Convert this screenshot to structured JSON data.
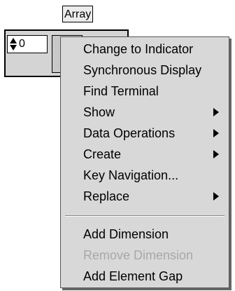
{
  "array_control": {
    "label": "Array",
    "index_value": "0"
  },
  "context_menu": {
    "items": [
      {
        "label": "Change to Indicator",
        "submenu": false,
        "enabled": true
      },
      {
        "label": "Synchronous Display",
        "submenu": false,
        "enabled": true
      },
      {
        "label": "Find Terminal",
        "submenu": false,
        "enabled": true
      },
      {
        "label": "Show",
        "submenu": true,
        "enabled": true
      },
      {
        "label": "Data Operations",
        "submenu": true,
        "enabled": true
      },
      {
        "label": "Create",
        "submenu": true,
        "enabled": true
      },
      {
        "label": "Key Navigation...",
        "submenu": false,
        "enabled": true
      },
      {
        "label": "Replace",
        "submenu": true,
        "enabled": true
      }
    ],
    "items_after_separator": [
      {
        "label": "Add Dimension",
        "submenu": false,
        "enabled": true
      },
      {
        "label": "Remove Dimension",
        "submenu": false,
        "enabled": false
      },
      {
        "label": "Add Element Gap",
        "submenu": false,
        "enabled": true
      }
    ]
  }
}
